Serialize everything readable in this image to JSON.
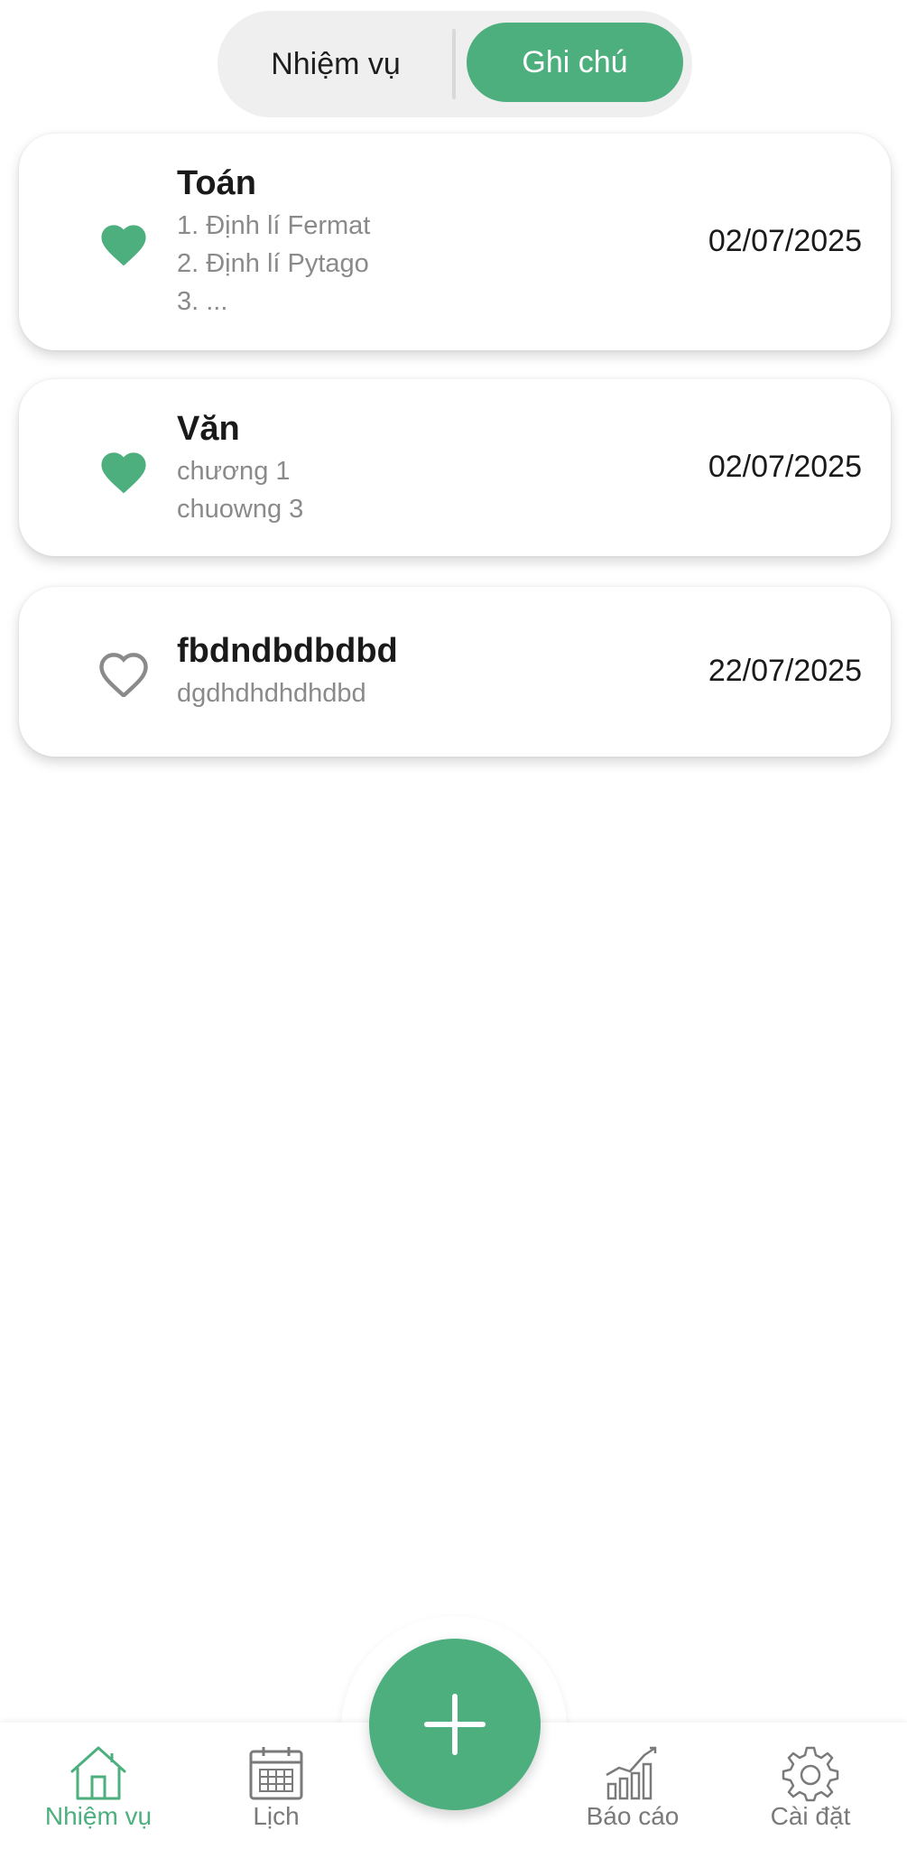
{
  "segment": {
    "left_label": "Nhiệm vụ",
    "right_label": "Ghi chú",
    "active": "right"
  },
  "notes": [
    {
      "title": "Toán",
      "lines": [
        "1. Định lí Fermat",
        "2. Định lí Pytago",
        "3. ..."
      ],
      "date": "02/07/2025",
      "favorite": true
    },
    {
      "title": "Văn",
      "lines": [
        "chương 1",
        "chuowng 3"
      ],
      "date": "02/07/2025",
      "favorite": true
    },
    {
      "title": "fbdndbdbdbd",
      "lines": [
        "dgdhdhdhdhdbd"
      ],
      "date": "22/07/2025",
      "favorite": false
    }
  ],
  "nav": {
    "items": [
      {
        "label": "Nhiệm vụ",
        "icon": "home-icon",
        "active": true
      },
      {
        "label": "Lịch",
        "icon": "calendar-icon",
        "active": false
      },
      {
        "label": "Báo cáo",
        "icon": "chart-icon",
        "active": false
      },
      {
        "label": "Cài đặt",
        "icon": "gear-icon",
        "active": false
      }
    ],
    "fab_icon": "plus-icon"
  },
  "colors": {
    "accent": "#4caf7d",
    "heart_outline": "#8a8a8a",
    "nav_inactive": "#7a7a7a"
  }
}
